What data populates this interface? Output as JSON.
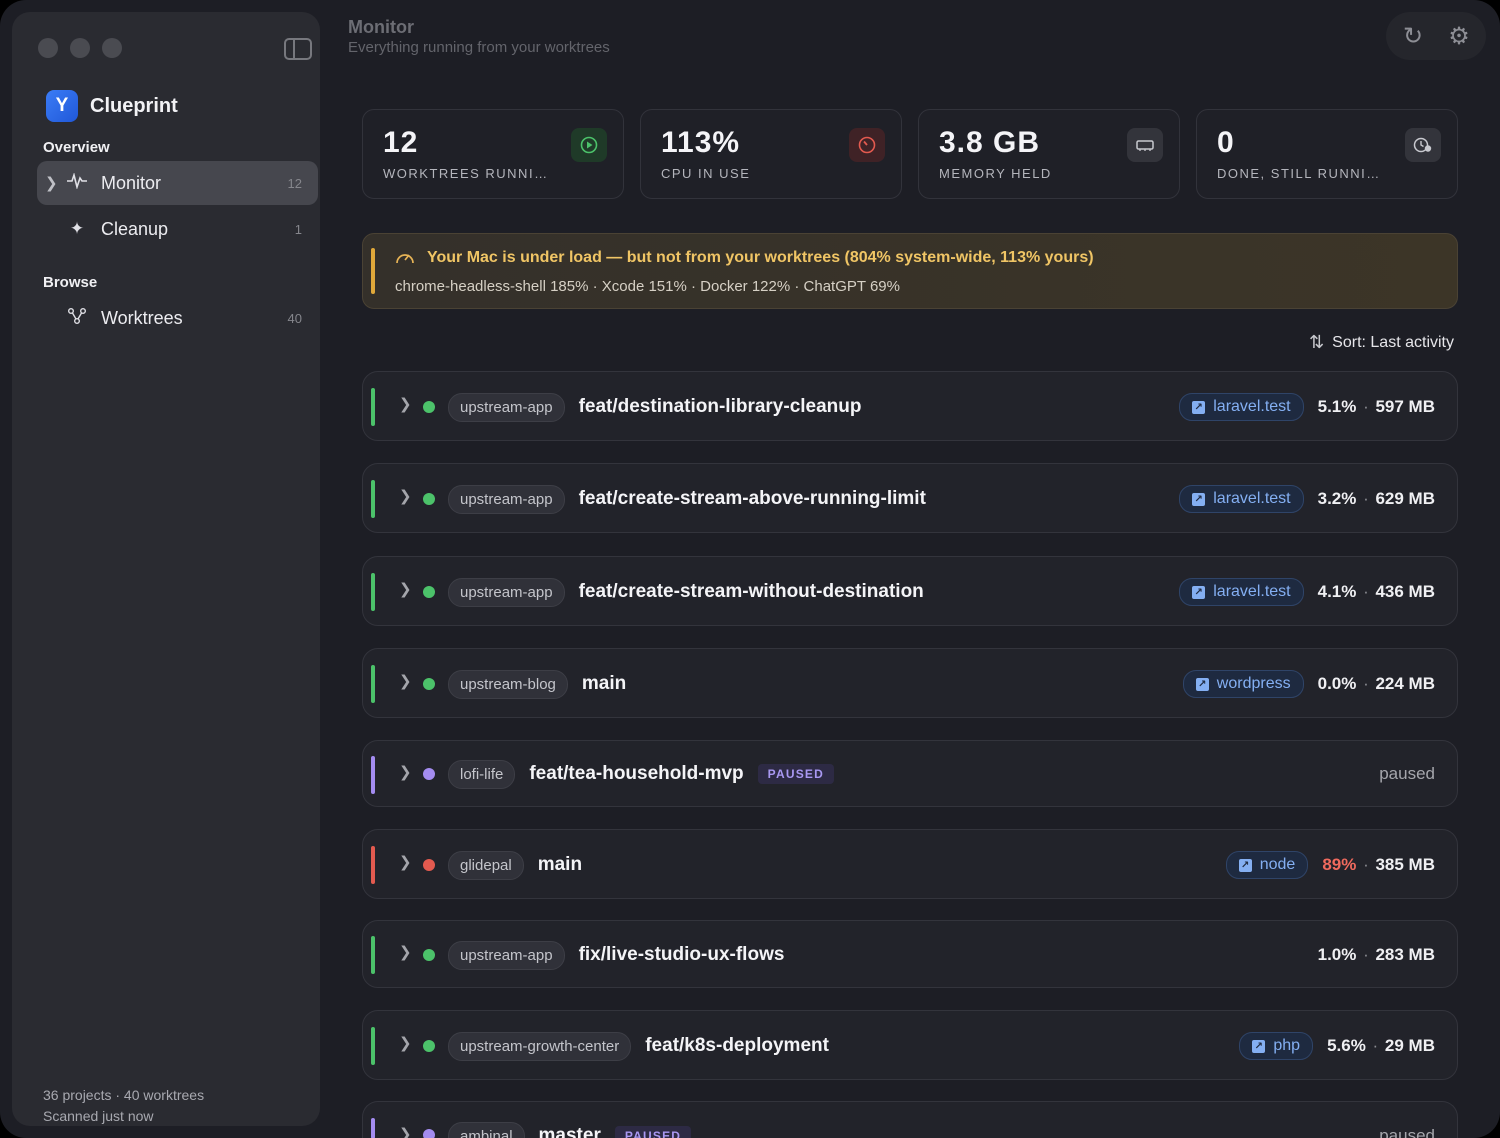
{
  "sidebar": {
    "brand": "Clueprint",
    "brand_icon": "branch-logo-icon",
    "sections": [
      {
        "title": "Overview"
      },
      {
        "title": "Browse"
      }
    ],
    "items": [
      {
        "label": "Monitor",
        "count": "12",
        "icon": "pulse-icon",
        "active": true
      },
      {
        "label": "Cleanup",
        "count": "1",
        "icon": "sparkle-icon"
      },
      {
        "label": "Worktrees",
        "count": "40",
        "icon": "branch-icon"
      }
    ],
    "footer": {
      "summary": "36 projects · 40 worktrees",
      "scan_status": "Scanned just now"
    }
  },
  "header": {
    "title": "Monitor",
    "subtitle": "Everything running from your worktrees"
  },
  "stats": [
    {
      "value": "12",
      "label": "WORKTREES RUNNING",
      "icon": "play-icon",
      "color": "#4cc26a"
    },
    {
      "value": "113%",
      "label": "CPU IN USE",
      "icon": "gauge-icon",
      "color": "#e35a4f"
    },
    {
      "value": "3.8 GB",
      "label": "MEMORY HELD",
      "icon": "memory-chip-icon",
      "color": "#b8b9c0"
    },
    {
      "value": "0",
      "label": "DONE, STILL RUNNING",
      "icon": "clock-check-icon",
      "color": "#b8b9c0"
    }
  ],
  "alert": {
    "title": "Your Mac is under load — but not from your worktrees (804% system-wide, 113% yours)",
    "detail": "chrome-headless-shell 185% · Xcode 151% · Docker 122% · ChatGPT 69%",
    "color": "#e0a83a"
  },
  "sort": {
    "label": "Sort: Last activity"
  },
  "colors": {
    "running": "#4cc26a",
    "paused": "#a48cf0",
    "hot": "#e35a4f"
  },
  "worktrees": [
    {
      "project": "upstream-app",
      "branch": "feat/destination-library-cleanup",
      "host": "laravel.test",
      "cpu": "5.1%",
      "mem": "597 MB",
      "status": "running"
    },
    {
      "project": "upstream-app",
      "branch": "feat/create-stream-above-running-limit",
      "host": "laravel.test",
      "cpu": "3.2%",
      "mem": "629 MB",
      "status": "running"
    },
    {
      "project": "upstream-app",
      "branch": "feat/create-stream-without-destination",
      "host": "laravel.test",
      "cpu": "4.1%",
      "mem": "436 MB",
      "status": "running"
    },
    {
      "project": "upstream-blog",
      "branch": "main",
      "host": "wordpress",
      "cpu": "0.0%",
      "mem": "224 MB",
      "status": "running"
    },
    {
      "project": "lofi-life",
      "branch": "feat/tea-household-mvp",
      "badge": "PAUSED",
      "right_text": "paused",
      "status": "paused"
    },
    {
      "project": "glidepal",
      "branch": "main",
      "host": "node",
      "cpu": "89%",
      "mem": "385 MB",
      "status": "hot"
    },
    {
      "project": "upstream-app",
      "branch": "fix/live-studio-ux-flows",
      "cpu": "1.0%",
      "mem": "283 MB",
      "status": "running"
    },
    {
      "project": "upstream-growth-center",
      "branch": "feat/k8s-deployment",
      "host": "php",
      "cpu": "5.6%",
      "mem": "29 MB",
      "status": "running"
    },
    {
      "project": "ambinal",
      "branch": "master",
      "badge": "PAUSED",
      "right_text": "paused",
      "status": "paused"
    }
  ]
}
